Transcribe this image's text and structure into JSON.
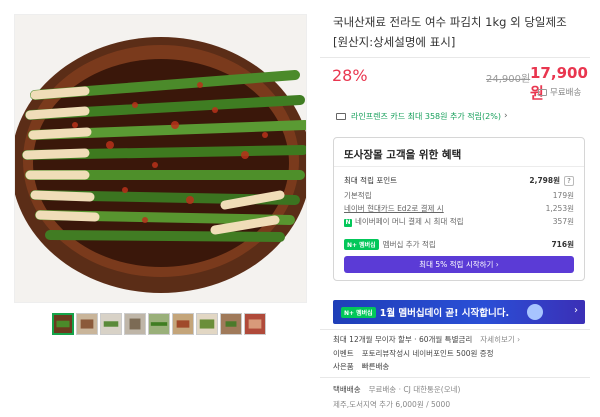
{
  "gallery": {
    "thumbnail_count": 9,
    "active_thumbnail": 1
  },
  "product": {
    "title": "국내산재료 전라도 여수 파김치 1kg 외 당일제조 [원산지:상세설명에 표시]",
    "discount": "28%",
    "original_price": "24,900원",
    "sale_price": "17,900원",
    "shipping_badge": "무료배송"
  },
  "card_banner": {
    "text": "라인프렌즈 카드 최대 358원 추가 적립(2%)",
    "chevron": "›"
  },
  "benefits": {
    "title": "또사장몰 고객을 위한 혜택",
    "max_points_label": "최대 적립 포인트",
    "max_points_value": "2,798원",
    "help": "?",
    "basic_label": "기본적립",
    "basic_value": "179원",
    "hyundai_label": "네이버 현대카드 Ed2로 결제 시",
    "hyundai_value": "1,253원",
    "npay_label": "네이버페이 머니 결제 시 최대 적립",
    "npay_value": "357원",
    "npay_icon": "N",
    "member_badge": "N+ 멤버십",
    "member_label": "멤버십 추가 적립",
    "member_value": "716원",
    "member_button": "최대 5% 적립 시작하기 ›"
  },
  "promo": {
    "badge": "N+ 멤버십",
    "text": "1월 멤버십데이 곧! 시작합니다.",
    "chevron": "›"
  },
  "info": {
    "installment": "최대 12개월 무이자 할부 · 60개월 특별금리",
    "installment_more": "자세히보기",
    "event_label": "이벤트",
    "event_text": "포토리뷰작성시 네이버포인트 500원 증정",
    "gift_label": "사은품",
    "gift_text": "빠른배송",
    "delivery_label": "택배배송",
    "delivery_text": "무료배송 · CJ 대한통운(오네)",
    "delivery_extra": "제주,도서지역 추가 6,000원 / 5000"
  },
  "colors": {
    "accent_red": "#e9364f",
    "naver_green": "#03c75a",
    "member_purple": "#5b3bd6"
  }
}
